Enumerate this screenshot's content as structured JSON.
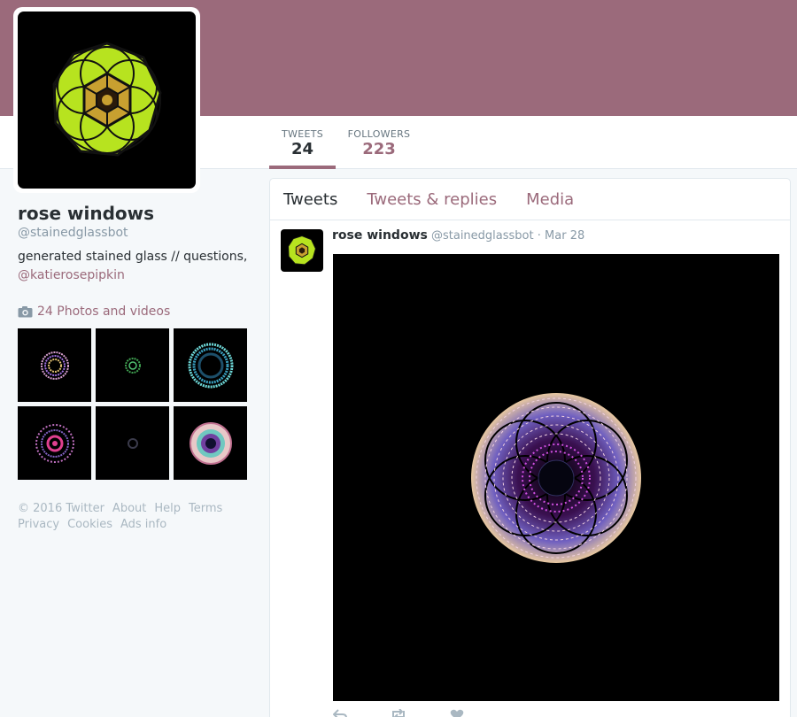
{
  "profile": {
    "name": "rose windows",
    "handle": "@stainedglassbot",
    "bio": "generated stained glass // questions,",
    "bio_link": "@katierosepipkin"
  },
  "nav": {
    "tweets_label": "TWEETS",
    "tweets_count": "24",
    "followers_label": "FOLLOWERS",
    "followers_count": "223"
  },
  "photos": {
    "label": "24 Photos and videos",
    "icon": "camera-icon"
  },
  "footer": {
    "links": [
      "© 2016 Twitter",
      "About",
      "Help",
      "Terms",
      "Privacy",
      "Cookies",
      "Ads info"
    ]
  },
  "timeline": {
    "tabs": [
      "Tweets",
      "Tweets & replies",
      "Media"
    ]
  },
  "tweet": {
    "name": "rose windows",
    "handle": "@stainedglassbot",
    "separator": "·",
    "date": "Mar 28"
  },
  "colors": {
    "accent": "#9b6a7b",
    "banner": "#9b6a7b",
    "background": "#f5f8fa"
  }
}
